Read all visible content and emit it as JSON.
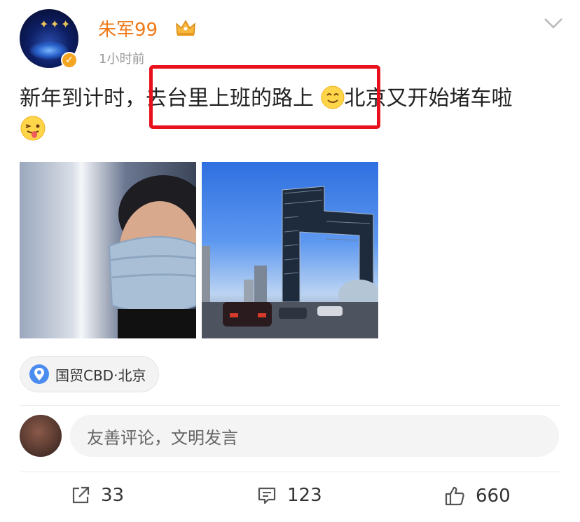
{
  "post": {
    "username": "朱军99",
    "time_ago": "1小时前",
    "content_line1": "新年到计时，去台里上班的路上",
    "content_line1_after": "北京又开始堵车啦",
    "location": "国贸CBD·北京"
  },
  "comment": {
    "placeholder": "友善评论，文明发言"
  },
  "actions": {
    "share_count": "33",
    "comment_count": "123",
    "like_count": "660"
  },
  "colors": {
    "username": "#f07a1a",
    "highlight": "#e8101b",
    "location_pin": "#4a8cf0",
    "verified_badge": "#f4a623"
  },
  "icons": [
    "crown-icon",
    "chevron-down-icon",
    "smile-emoji-icon",
    "wink-tongue-emoji-icon",
    "location-pin-icon",
    "share-icon",
    "comment-icon",
    "like-icon",
    "verified-icon"
  ]
}
